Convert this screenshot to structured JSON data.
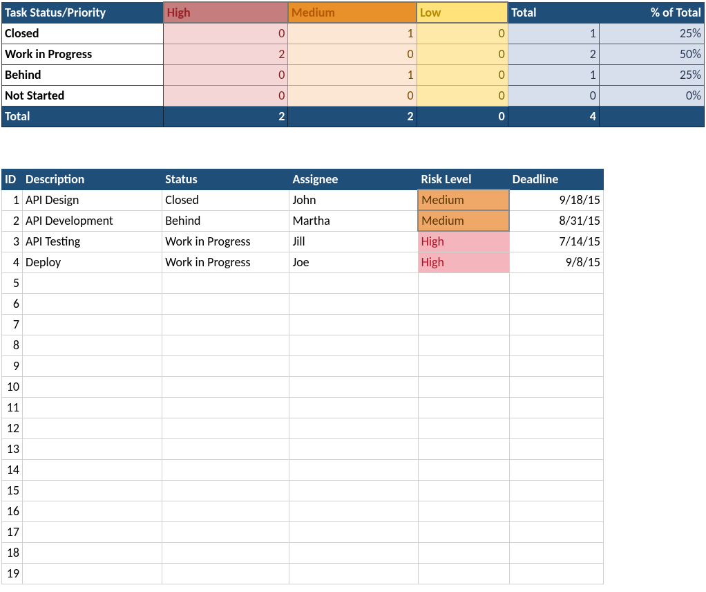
{
  "summary": {
    "headers": {
      "status": "Task Status/Priority",
      "high": "High",
      "medium": "Medium",
      "low": "Low",
      "total": "Total",
      "pct": "% of Total"
    },
    "rows": [
      {
        "label": "Closed",
        "high": "0",
        "medium": "1",
        "low": "0",
        "total": "1",
        "pct": "25%"
      },
      {
        "label": "Work in Progress",
        "high": "2",
        "medium": "0",
        "low": "0",
        "total": "2",
        "pct": "50%"
      },
      {
        "label": "Behind",
        "high": "0",
        "medium": "1",
        "low": "0",
        "total": "1",
        "pct": "25%"
      },
      {
        "label": "Not Started",
        "high": "0",
        "medium": "0",
        "low": "0",
        "total": "0",
        "pct": "0%"
      }
    ],
    "totals": {
      "label": "Total",
      "high": "2",
      "medium": "2",
      "low": "0",
      "total": "4",
      "pct": ""
    }
  },
  "tasks": {
    "headers": {
      "id": "ID",
      "description": "Description",
      "status": "Status",
      "assignee": "Assignee",
      "risk": "Risk Level",
      "deadline": "Deadline"
    },
    "rows": [
      {
        "id": "1",
        "description": "API Design",
        "status": "Closed",
        "assignee": "John",
        "risk": "Medium",
        "deadline": "9/18/15"
      },
      {
        "id": "2",
        "description": "API Development",
        "status": "Behind",
        "assignee": "Martha",
        "risk": "Medium",
        "deadline": "8/31/15"
      },
      {
        "id": "3",
        "description": "API Testing",
        "status": "Work in Progress",
        "assignee": "Jill",
        "risk": "High",
        "deadline": "7/14/15"
      },
      {
        "id": "4",
        "description": "Deploy",
        "status": "Work in Progress",
        "assignee": "Joe",
        "risk": "High",
        "deadline": "9/8/15"
      }
    ],
    "empty_ids": [
      "5",
      "6",
      "7",
      "8",
      "9",
      "10",
      "11",
      "12",
      "13",
      "14",
      "15",
      "16",
      "17",
      "18",
      "19"
    ]
  },
  "chart_data": {
    "type": "table",
    "title": "Task Status/Priority summary",
    "categories": [
      "Closed",
      "Work in Progress",
      "Behind",
      "Not Started"
    ],
    "series": [
      {
        "name": "High",
        "values": [
          0,
          2,
          0,
          0
        ]
      },
      {
        "name": "Medium",
        "values": [
          1,
          0,
          1,
          0
        ]
      },
      {
        "name": "Low",
        "values": [
          0,
          0,
          0,
          0
        ]
      },
      {
        "name": "Total",
        "values": [
          1,
          2,
          1,
          0
        ]
      }
    ],
    "pct_of_total": [
      25,
      50,
      25,
      0
    ],
    "column_totals": {
      "High": 2,
      "Medium": 2,
      "Low": 0,
      "Total": 4
    }
  }
}
